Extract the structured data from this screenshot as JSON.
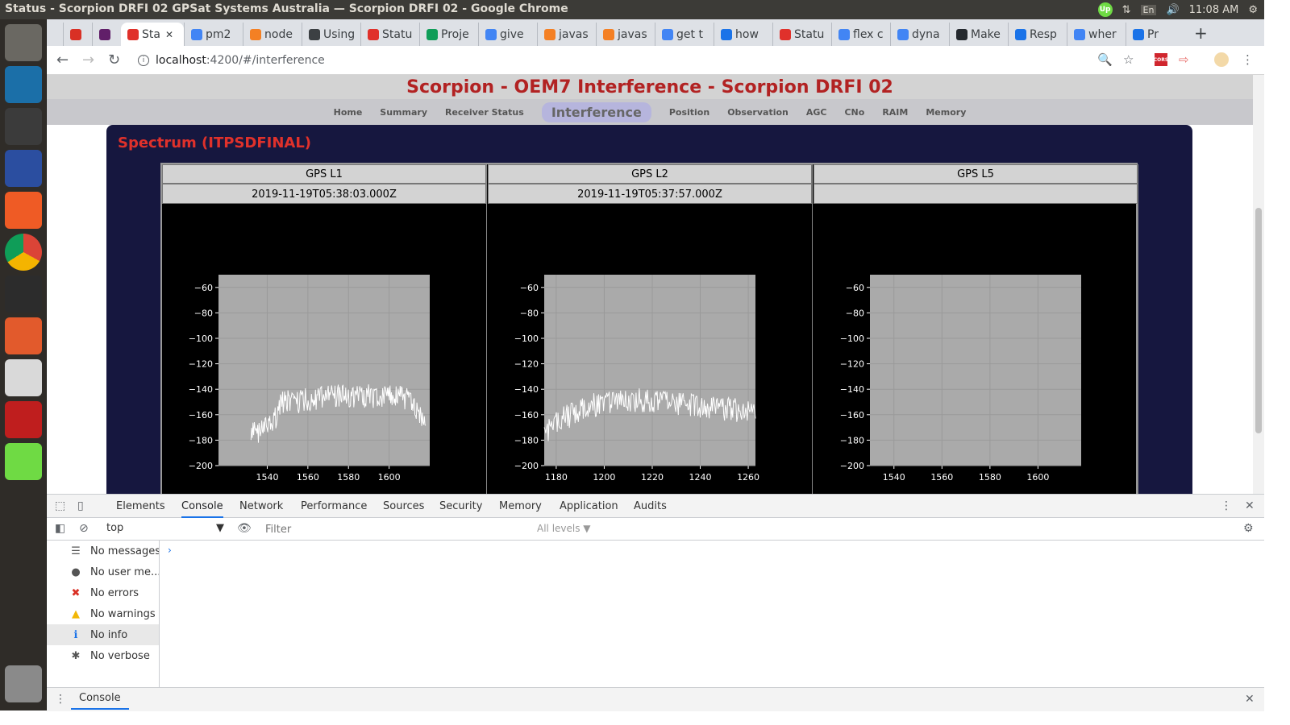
{
  "os": {
    "window_title": "Status - Scorpion DRFI 02 GPSat Systems Australia — Scorpion DRFI 02 - Google Chrome",
    "keyboard_layout": "En",
    "clock": "11:08 AM",
    "upwork_badge": "Up"
  },
  "browser": {
    "tabs": [
      {
        "label": "",
        "color": "#d93025"
      },
      {
        "label": "",
        "color": "#611f69"
      },
      {
        "label": "Sta",
        "color": "#e0312b",
        "active": true
      },
      {
        "label": "pm2",
        "color": "#4285f4"
      },
      {
        "label": "node",
        "color": "#f48024"
      },
      {
        "label": "Using",
        "color": "#3c4043"
      },
      {
        "label": "Statu",
        "color": "#e0312b"
      },
      {
        "label": "Proje",
        "color": "#0f9d58"
      },
      {
        "label": "give",
        "color": "#4285f4"
      },
      {
        "label": "javas",
        "color": "#f48024"
      },
      {
        "label": "javas",
        "color": "#f48024"
      },
      {
        "label": "get t",
        "color": "#4285f4"
      },
      {
        "label": "how",
        "color": "#1a73e8"
      },
      {
        "label": "Statu",
        "color": "#e0312b"
      },
      {
        "label": "flex c",
        "color": "#4285f4"
      },
      {
        "label": "dyna",
        "color": "#4285f4"
      },
      {
        "label": "Make",
        "color": "#24292e"
      },
      {
        "label": "Resp",
        "color": "#1a73e8"
      },
      {
        "label": "wher",
        "color": "#4285f4"
      },
      {
        "label": "Pr",
        "color": "#1a73e8"
      }
    ],
    "new_tab_glyph": "+",
    "address": {
      "host": "localhost",
      "rest": ":4200/#/interference"
    },
    "cors_badge": "CORS"
  },
  "page": {
    "title": "Scorpion - OEM7 Interference - Scorpion DRFI 02",
    "nav": [
      "Home",
      "Summary",
      "Receiver Status",
      "Interference",
      "Position",
      "Observation",
      "AGC",
      "CNo",
      "RAIM",
      "Memory"
    ],
    "active_nav": "Interference",
    "panel_title": "Spectrum (ITPSDFINAL)",
    "columns": [
      {
        "band": "GPS L1",
        "timestamp": "2019-11-19T05:38:03.000Z"
      },
      {
        "band": "GPS L2",
        "timestamp": "2019-11-19T05:37:57.000Z"
      },
      {
        "band": "GPS L5",
        "timestamp": ""
      }
    ]
  },
  "chart_data": [
    {
      "type": "line",
      "series": [
        {
          "values": [
            [
              1532,
              -172
            ],
            [
              1535,
              -168
            ],
            [
              1538,
              -170
            ],
            [
              1540,
              -165
            ],
            [
              1542,
              -162
            ],
            [
              1544,
              -158
            ],
            [
              1546,
              -150
            ],
            [
              1548,
              -146
            ],
            [
              1550,
              -145
            ],
            [
              1555,
              -146
            ],
            [
              1560,
              -143
            ],
            [
              1565,
              -142
            ],
            [
              1570,
              -141
            ],
            [
              1575,
              -140
            ],
            [
              1580,
              -141
            ],
            [
              1585,
              -140
            ],
            [
              1590,
              -141
            ],
            [
              1595,
              -142
            ],
            [
              1600,
              -141
            ],
            [
              1605,
              -142
            ],
            [
              1610,
              -145
            ],
            [
              1612,
              -148
            ],
            [
              1614,
              -152
            ],
            [
              1616,
              -155
            ],
            [
              1618,
              -158
            ]
          ]
        }
      ],
      "xticks": [
        1540,
        1560,
        1580,
        1600
      ],
      "yticks": [
        -60,
        -80,
        -100,
        -120,
        -140,
        -160,
        -180,
        -200
      ],
      "xlim": [
        1516,
        1620
      ],
      "ylim": [
        -200,
        -50
      ],
      "grid": true
    },
    {
      "type": "line",
      "series": [
        {
          "values": [
            [
              1175,
              -172
            ],
            [
              1177,
              -166
            ],
            [
              1180,
              -162
            ],
            [
              1183,
              -158
            ],
            [
              1186,
              -156
            ],
            [
              1190,
              -152
            ],
            [
              1195,
              -148
            ],
            [
              1200,
              -146
            ],
            [
              1205,
              -144
            ],
            [
              1210,
              -145
            ],
            [
              1215,
              -144
            ],
            [
              1220,
              -145
            ],
            [
              1225,
              -146
            ],
            [
              1230,
              -147
            ],
            [
              1235,
              -148
            ],
            [
              1240,
              -149
            ],
            [
              1245,
              -150
            ],
            [
              1250,
              -151
            ],
            [
              1255,
              -152
            ],
            [
              1260,
              -153
            ],
            [
              1263,
              -154
            ]
          ]
        }
      ],
      "xticks": [
        1180,
        1200,
        1220,
        1240,
        1260
      ],
      "yticks": [
        -60,
        -80,
        -100,
        -120,
        -140,
        -160,
        -180,
        -200
      ],
      "xlim": [
        1175,
        1263
      ],
      "ylim": [
        -200,
        -50
      ],
      "grid": true
    },
    {
      "type": "line",
      "series": [],
      "xticks": [
        1540,
        1560,
        1580,
        1600
      ],
      "yticks": [
        -60,
        -80,
        -100,
        -120,
        -140,
        -160,
        -180,
        -200
      ],
      "xlim": [
        1530,
        1618
      ],
      "ylim": [
        -200,
        -50
      ],
      "grid": true
    }
  ],
  "devtools": {
    "tabs": [
      "Elements",
      "Console",
      "Network",
      "Performance",
      "Sources",
      "Security",
      "Memory",
      "Application",
      "Audits"
    ],
    "active_tab": "Console",
    "context": "top",
    "filter_placeholder": "Filter",
    "levels": "All levels ▼",
    "sidebar": [
      {
        "label": "No messages",
        "icon": "list-icon"
      },
      {
        "label": "No user me...",
        "icon": "user-icon"
      },
      {
        "label": "No errors",
        "icon": "error-icon",
        "color": "#d93025"
      },
      {
        "label": "No warnings",
        "icon": "warning-icon",
        "color": "#f2b705"
      },
      {
        "label": "No info",
        "icon": "info-icon",
        "color": "#1a73e8",
        "selected": true
      },
      {
        "label": "No verbose",
        "icon": "bug-icon"
      }
    ],
    "prompt": "›",
    "drawer_tab": "Console"
  },
  "launcher": [
    {
      "name": "dash-icon",
      "color": "#6a6862"
    },
    {
      "name": "remmina-icon",
      "color": "#1b6fa8"
    },
    {
      "name": "sublime-text-icon",
      "color": "#3b3b3b"
    },
    {
      "name": "remote-desktop-icon",
      "color": "#2b4ea0"
    },
    {
      "name": "postman-icon",
      "color": "#ef5b25"
    },
    {
      "name": "chrome-icon",
      "color": "#ffffff"
    },
    {
      "name": "terminal-icon",
      "color": "#2c2c2c"
    },
    {
      "name": "files-icon",
      "color": "#e25a2c"
    },
    {
      "name": "text-editor-icon",
      "color": "#d9d9d9"
    },
    {
      "name": "filezilla-icon",
      "color": "#bf1e1e"
    },
    {
      "name": "upwork-icon",
      "color": "#6fda44"
    },
    {
      "name": "trash-icon",
      "color": "#8a8a8a"
    }
  ]
}
